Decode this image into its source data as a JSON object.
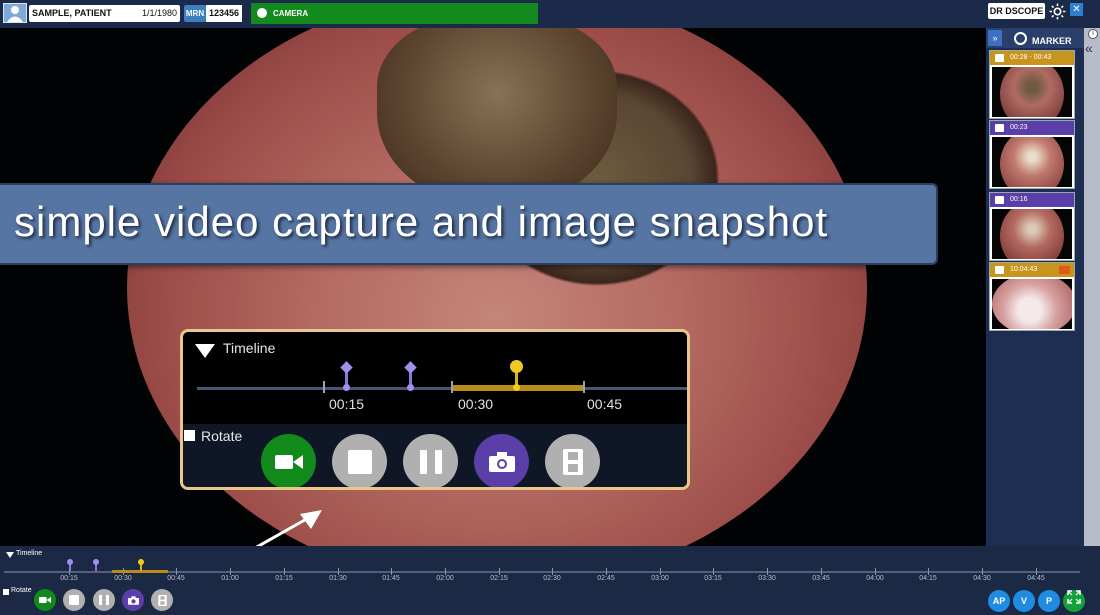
{
  "patient": {
    "name": "SAMPLE, PATIENT",
    "dob": "1/1/1980",
    "mrn_label": "MRN",
    "mrn": "123456"
  },
  "camera": {
    "label": "CAMERA",
    "status_color": "#128a1e"
  },
  "doctor": "DR DSCOPE",
  "banner": "simple video capture and image snapshot",
  "zoom_timeline": {
    "title": "Timeline",
    "ticks": [
      "00:15",
      "00:30",
      "00:45"
    ],
    "rotate_label": "Rotate"
  },
  "side": {
    "marker_label": "MARKER",
    "markers": [
      {
        "type": "video-clip",
        "time": "00:28 - 00:43",
        "color": "#c7951d"
      },
      {
        "type": "snapshot",
        "time": "00:23",
        "color": "#5b3fa8"
      },
      {
        "type": "snapshot",
        "time": "00:16",
        "color": "#5b3fa8"
      },
      {
        "type": "video",
        "time": "10:04:43",
        "color": "#c7951d"
      }
    ]
  },
  "timeline": {
    "title": "Timeline",
    "rotate_label": "Rotate",
    "ticks": [
      "00:15",
      "00:30",
      "00:45",
      "01:00",
      "01:15",
      "01:30",
      "01:45",
      "02:00",
      "02:15",
      "02:30",
      "02:45",
      "03:00",
      "03:15",
      "03:30",
      "03:45",
      "04:00",
      "04:15",
      "04:30",
      "04:45"
    ]
  },
  "buttons": {
    "record": "record-video",
    "stop": "stop",
    "pause": "pause",
    "snapshot": "camera-snapshot",
    "film": "film-clip"
  },
  "view_buttons": [
    "AP",
    "V",
    "P"
  ],
  "colors": {
    "record": "#118a1b",
    "gray": "#b0b0b0",
    "snapshot": "#5b3fa8",
    "accent": "#1f8be3"
  }
}
